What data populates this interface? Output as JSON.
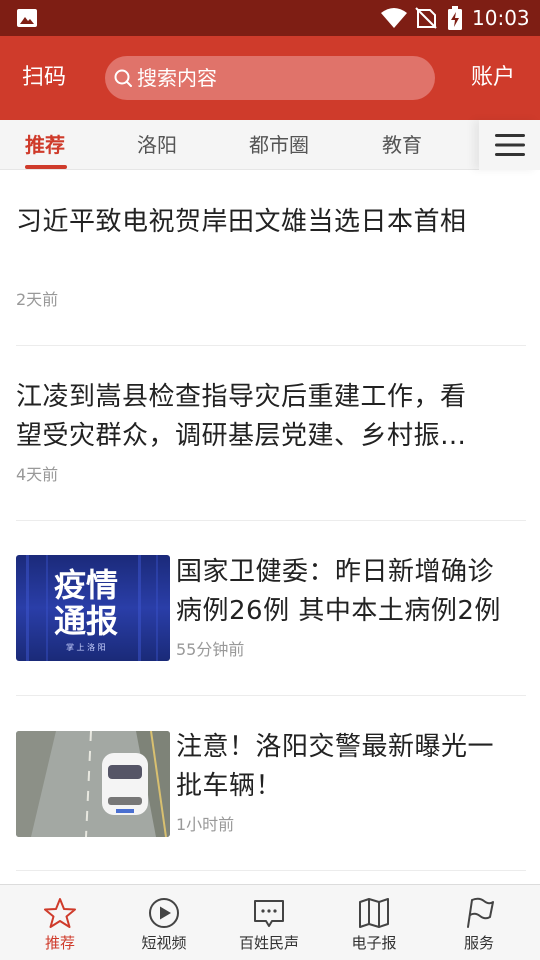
{
  "status_bar": {
    "time": "10:03",
    "icons": [
      "gallery-icon",
      "wifi-icon",
      "no-sim-signal-icon",
      "battery-charging-icon"
    ]
  },
  "header": {
    "scan_label": "扫码",
    "search_placeholder": "搜索内容",
    "account_label": "账户",
    "color": "#cf3b2b"
  },
  "tabs": {
    "items": [
      {
        "label": "推荐",
        "active": true
      },
      {
        "label": "洛阳",
        "active": false
      },
      {
        "label": "都市圈",
        "active": false
      },
      {
        "label": "教育",
        "active": false
      }
    ],
    "menu_icon": "hamburger-menu-icon"
  },
  "feed": [
    {
      "title": "习近平致电祝贺岸田文雄当选日本首相",
      "time": "2天前"
    },
    {
      "title_line1": "江凌到嵩县检查指导灾后重建工作，看",
      "title_line2": "望受灾群众，调研基层党建、乡村振…",
      "time": "4天前"
    },
    {
      "title_line1": "国家卫健委：昨日新增确诊",
      "title_line2": "病例26例 其中本土病例2例",
      "time": "55分钟前",
      "thumb": {
        "line1": "疫情",
        "line2": "通报",
        "caption": "掌 上 洛 阳"
      }
    },
    {
      "title_line1": "注意！洛阳交警最新曝光一",
      "title_line2": "批车辆！",
      "time": "1小时前",
      "thumb": {
        "description": "car-on-road-photo"
      }
    }
  ],
  "bottom_nav": [
    {
      "label": "推荐",
      "icon": "star-icon",
      "active": true
    },
    {
      "label": "短视频",
      "icon": "play-circle-icon",
      "active": false
    },
    {
      "label": "百姓民声",
      "icon": "chat-bubble-icon",
      "active": false
    },
    {
      "label": "电子报",
      "icon": "open-book-icon",
      "active": false
    },
    {
      "label": "服务",
      "icon": "flag-icon",
      "active": false
    }
  ]
}
